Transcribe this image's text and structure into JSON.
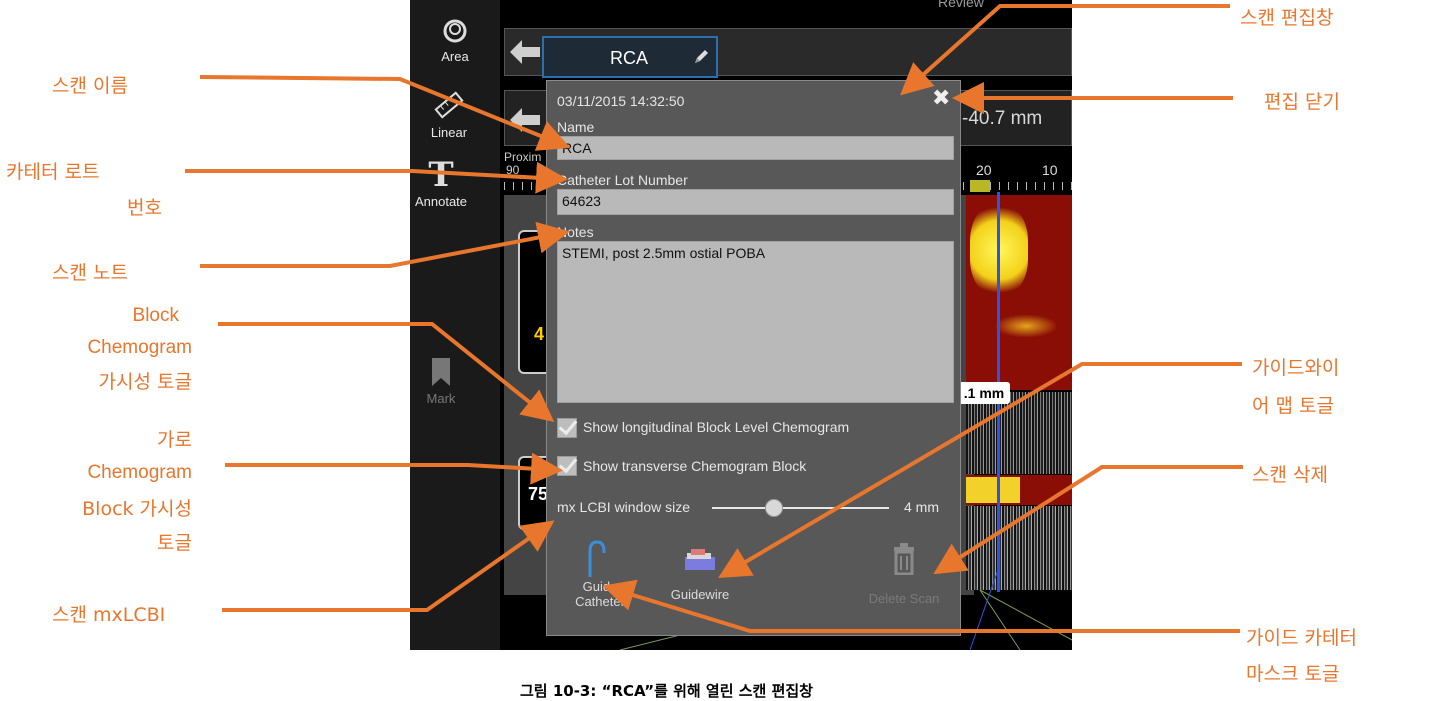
{
  "app": {
    "tools": [
      {
        "label": "Area",
        "icon": "area-icon"
      },
      {
        "label": "Linear",
        "icon": "ruler-icon"
      },
      {
        "label": "Annotate",
        "icon": "text-icon"
      },
      {
        "label": "Mark",
        "icon": "bookmark-icon"
      }
    ],
    "tab_name": "RCA",
    "top_right_label": "Review",
    "measure_text": "-40.7 mm",
    "proximal_label": "Proxim",
    "scale_left": "90",
    "scale_ticks": [
      "20",
      "10"
    ],
    "measure_badge": ".1 mm",
    "left_card_bottom": "75",
    "left_card_top": "4"
  },
  "dialog": {
    "timestamp": "03/11/2015 14:32:50",
    "close_glyph": "✖",
    "name_label": "Name",
    "name_value": "RCA",
    "lot_label": "Catheter Lot Number",
    "lot_value": "64623",
    "notes_label": "Notes",
    "notes_value": "STEMI, post 2.5mm ostial POBA",
    "check_longitudinal": "Show longitudinal Block Level Chemogram",
    "check_transverse": "Show transverse Chemogram Block",
    "slider_label": "mx LCBI window size",
    "slider_value": "4 mm",
    "slider_fraction": 0.35,
    "btn_guide_catheter": "Guide\nCatheter",
    "btn_guidewire": "Guidewire",
    "btn_delete": "Delete Scan"
  },
  "callouts": {
    "scan_name": "스캔 이름",
    "catheter_lot_1": "카테터 로트",
    "catheter_lot_2": "번호",
    "scan_notes": "스캔 노트",
    "block_vis_1": "Block",
    "block_vis_2": "Chemogram",
    "block_vis_3": "가시성 토글",
    "trans_vis_1": "가로",
    "trans_vis_2": "Chemogram",
    "trans_vis_3": "Block 가시성",
    "trans_vis_4": "토글",
    "scan_mxlcbi": "스캔 mxLCBI",
    "scan_edit_window": "스캔 편집창",
    "close_edit": "편집 닫기",
    "guidewire_map_1": "가이드와이",
    "guidewire_map_2": "어 맵 토글",
    "delete_scan": "스캔 삭제",
    "guide_mask_1": "가이드 카테터",
    "guide_mask_2": "마스크 토글"
  },
  "caption": "그림 10-3: “RCA”를 위해 열린 스캔 편집창",
  "colors": {
    "callout": "#e8762d",
    "dialog_bg": "#585858",
    "field_bg": "#b9b9b9"
  }
}
